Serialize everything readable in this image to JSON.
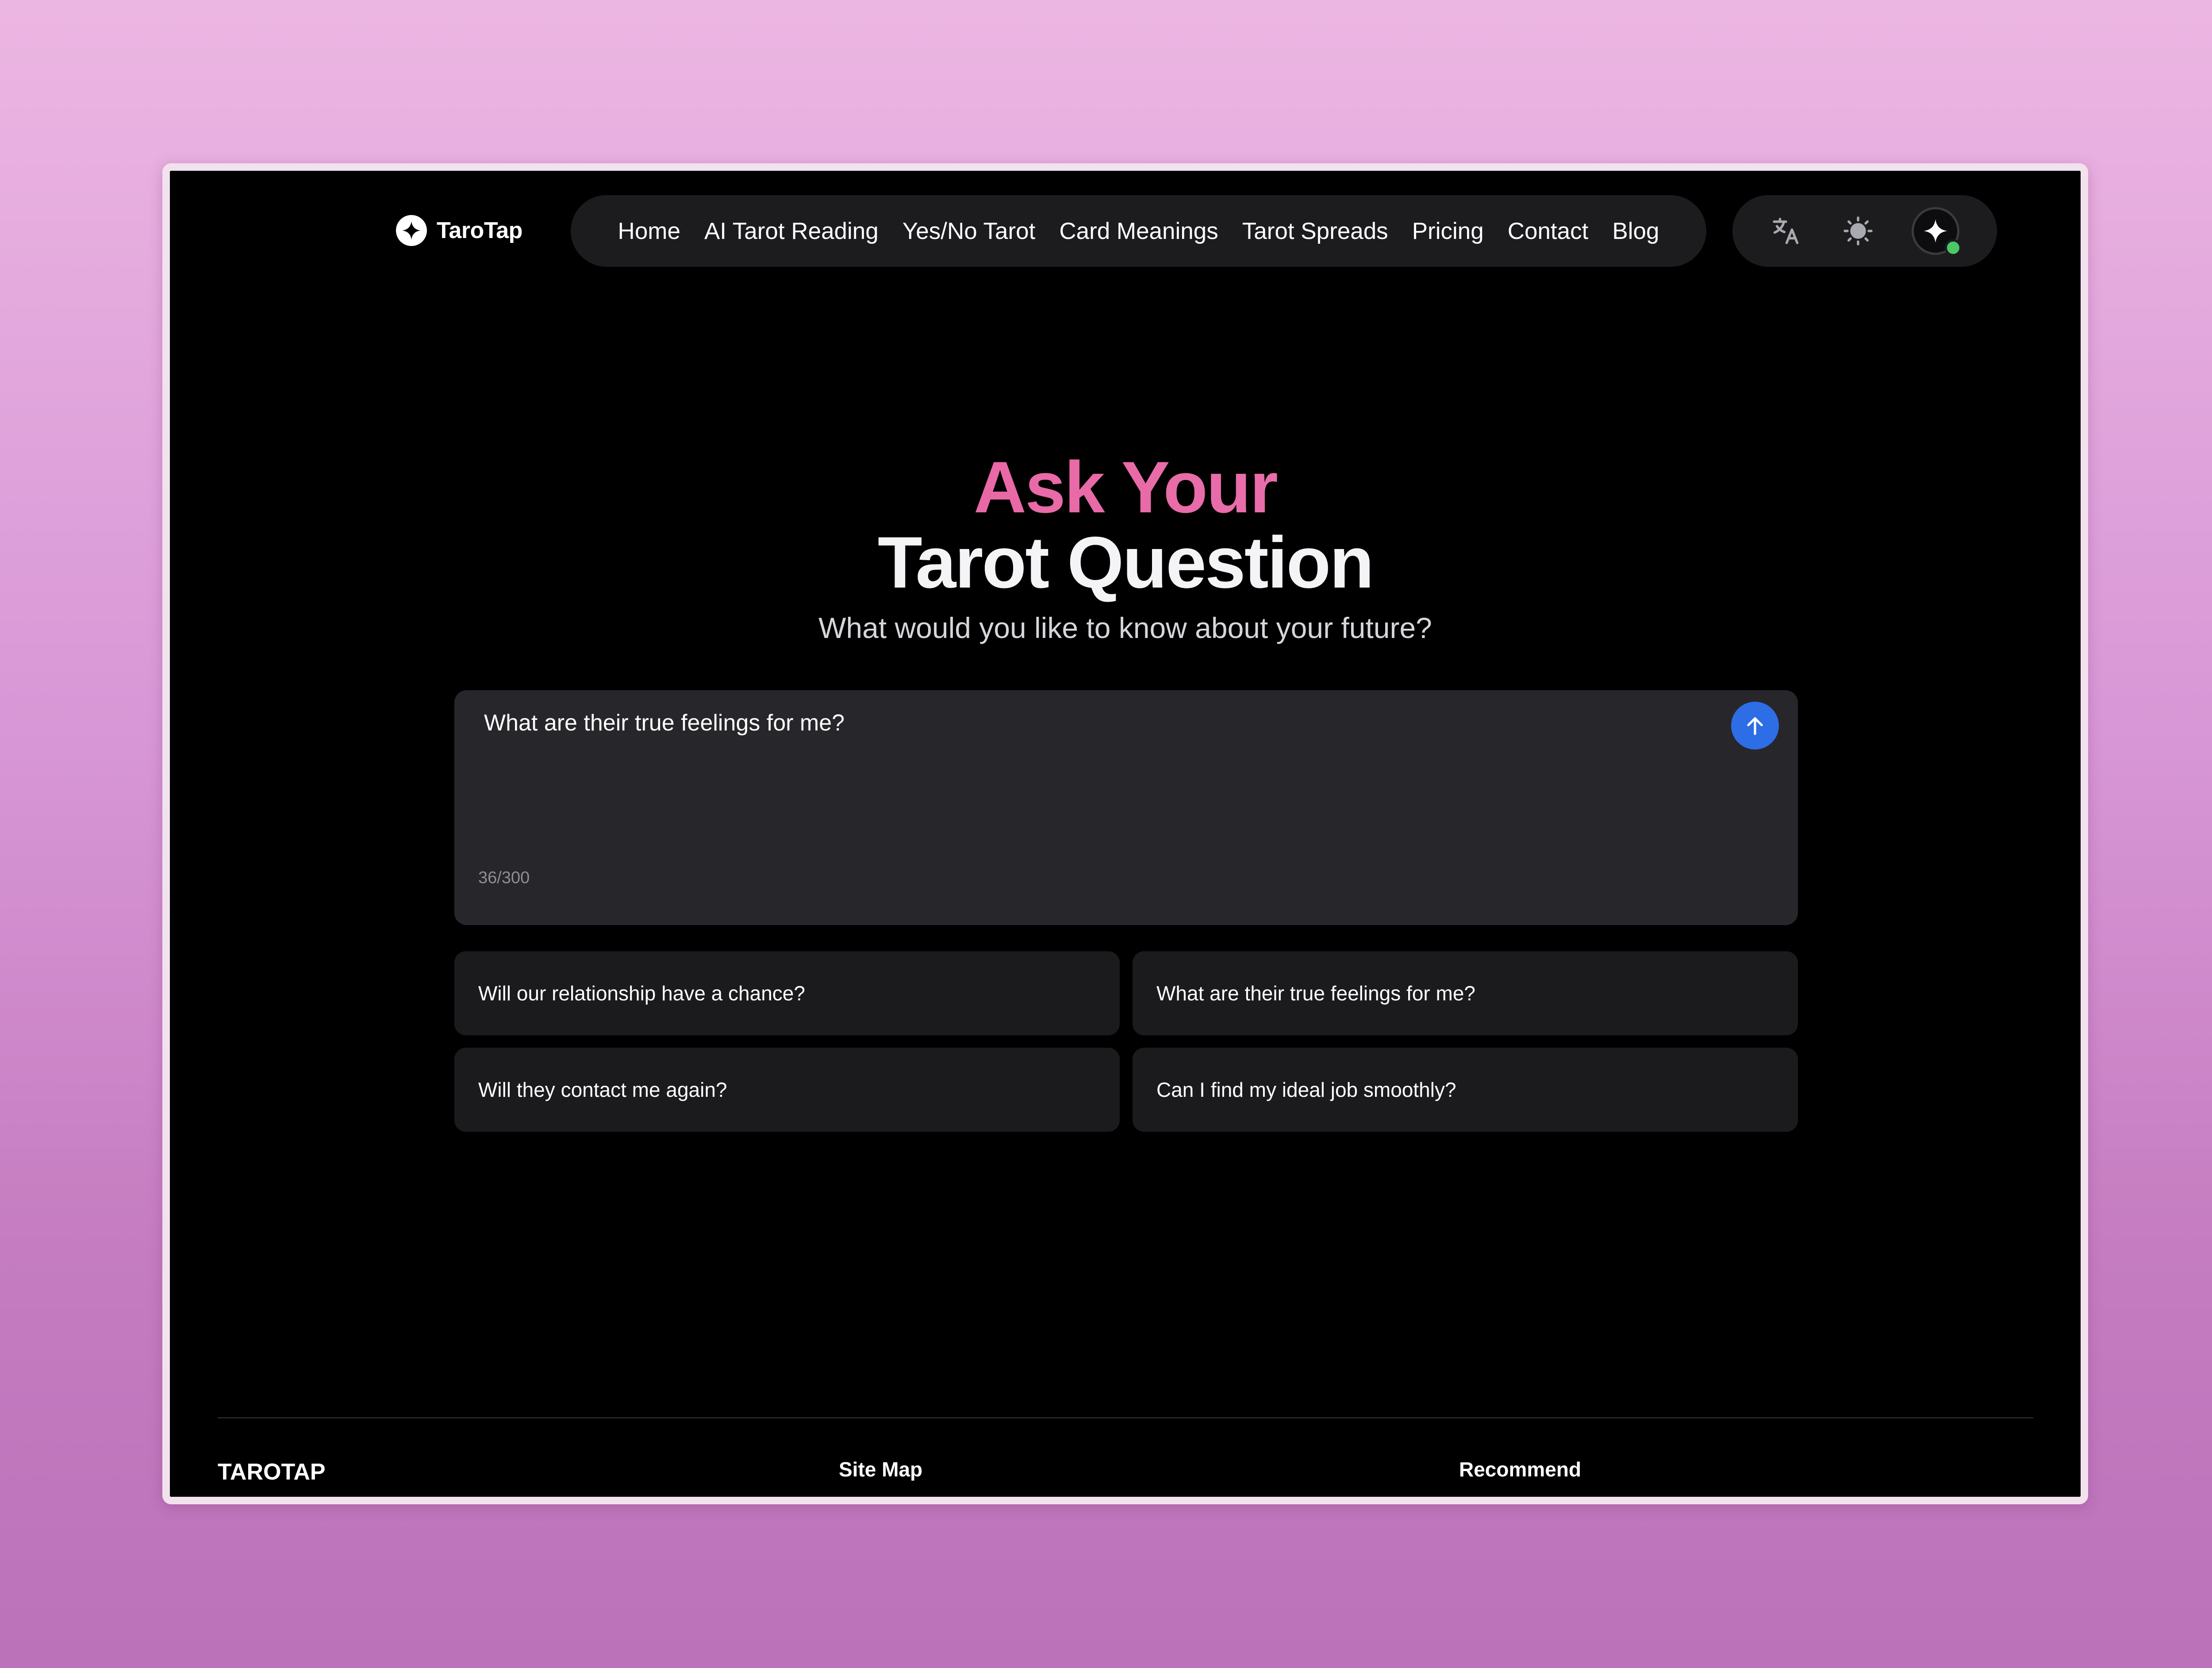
{
  "header": {
    "logo_text": "TaroTap",
    "nav": [
      {
        "label": "Home"
      },
      {
        "label": "AI Tarot Reading"
      },
      {
        "label": "Yes/No Tarot"
      },
      {
        "label": "Card Meanings"
      },
      {
        "label": "Tarot Spreads"
      },
      {
        "label": "Pricing"
      },
      {
        "label": "Contact"
      },
      {
        "label": "Blog"
      }
    ],
    "tools": {
      "translate_icon": "translate-icon",
      "theme_icon": "sun-icon",
      "avatar_icon": "sparkle-icon",
      "status_color": "#4cc766"
    }
  },
  "hero": {
    "title_line_1": "Ask Your",
    "title_line_2": "Tarot Question",
    "subtitle": "What would you like to know about your future?",
    "accent_color": "#e85b98"
  },
  "question": {
    "value": "What are their true feelings for me?",
    "counter": "36/300",
    "send_icon": "arrow-up-icon",
    "send_color": "#2d6ee6"
  },
  "suggestions": [
    {
      "label": "Will our relationship have a chance?"
    },
    {
      "label": "What are their true feelings for me?"
    },
    {
      "label": "Will they contact me again?"
    },
    {
      "label": "Can I find my ideal job smoothly?"
    }
  ],
  "footer": {
    "brand": "TAROTAP",
    "site_map": "Site Map",
    "recommend": "Recommend"
  }
}
